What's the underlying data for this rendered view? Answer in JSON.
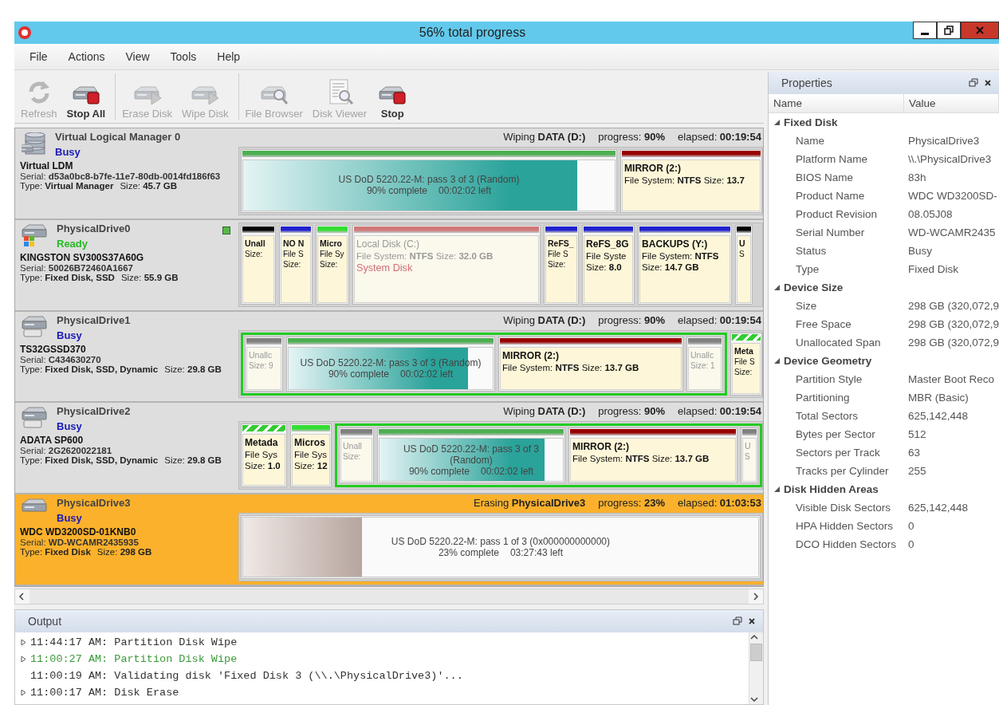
{
  "window": {
    "title": "56% total progress"
  },
  "menu": [
    "File",
    "Actions",
    "View",
    "Tools",
    "Help"
  ],
  "toolbar_groups": [
    [
      {
        "label": "Refresh",
        "kind": "refresh",
        "disabled": true
      },
      {
        "label": "Stop All",
        "kind": "stop",
        "disabled": false
      }
    ],
    [
      {
        "label": "Erase Disk",
        "kind": "play",
        "disabled": true
      },
      {
        "label": "Wipe Disk",
        "kind": "play",
        "disabled": true
      }
    ],
    [
      {
        "label": "File Browser",
        "kind": "browse",
        "disabled": true
      },
      {
        "label": "Disk Viewer",
        "kind": "viewer",
        "disabled": true
      },
      {
        "label": "Stop",
        "kind": "stop",
        "disabled": false
      }
    ]
  ],
  "disks": [
    {
      "kind": "virtual",
      "name": "Virtual Logical Manager 0",
      "status": {
        "text": "Busy",
        "kind": "busy"
      },
      "selected": false,
      "indicator": false,
      "model": "Virtual LDM",
      "serial": "Serial: **d53a0bc8-b7fe-11e7-80db-0014fd186f63**",
      "type": "Type: **Virtual Manager**",
      "size": "Size: **45.7 GB**",
      "task": {
        "action": "Wiping **DATA (D:)**",
        "progress": "progress: **90%**",
        "elapsed": "elapsed: **00:19:54**"
      },
      "partitions": [
        {
          "kind": "wipe",
          "color": "#4caf50",
          "level": 0.9,
          "text": "US DoD 5220.22-M: pass 3 of 3 (Random)",
          "complete": "90% complete",
          "left": "00:02:02 left"
        },
        {
          "kind": "volume",
          "color": "#990000",
          "dimmed": false,
          "label": "MIRROR (2:)",
          "lines": [
            "File System: **NTFS** Size: **13.7**"
          ]
        }
      ]
    },
    {
      "kind": "system",
      "name": "PhysicalDrive0",
      "status": {
        "text": "Ready",
        "kind": "ready"
      },
      "selected": false,
      "indicator": true,
      "model": "KINGSTON SV300S37A60G",
      "serial": "Serial: **50026B72460A1667**",
      "type": "Type: **Fixed Disk, SSD**",
      "size": "Size: **55.9 GB**",
      "partitions": [
        {
          "kind": "volume",
          "color": "#000000",
          "dimmed": false,
          "label": "Unall",
          "lines": [
            "Size:"
          ]
        },
        {
          "kind": "volume",
          "color": "#2020d0",
          "dimmed": false,
          "label": "NO N",
          "lines": [
            "File S",
            "Size:"
          ]
        },
        {
          "kind": "volume",
          "color": "#33dd33",
          "dimmed": false,
          "label": "Micro",
          "lines": [
            "File Sy",
            "Size:"
          ]
        },
        {
          "kind": "volume",
          "color": "#d07878",
          "dimmed": true,
          "label": "Local Disk (C:)",
          "lines": [
            "File System: **NTFS** Size: **32.0 GB**"
          ],
          "note": "System Disk"
        },
        {
          "kind": "volume",
          "color": "#2020d0",
          "dimmed": false,
          "label": "ReFS_",
          "lines": [
            "File S",
            "Size:"
          ]
        },
        {
          "kind": "volume",
          "color": "#2020d0",
          "dimmed": false,
          "label": "ReFS_8G",
          "lines": [
            "File Syste",
            "Size: **8.0**"
          ]
        },
        {
          "kind": "volume",
          "color": "#2020d0",
          "dimmed": false,
          "label": "BACKUPS (Y:)",
          "lines": [
            "File System: **NTFS**",
            "Size: **14.7 GB**"
          ]
        },
        {
          "kind": "volume",
          "color": "#000000",
          "dimmed": false,
          "label": "U",
          "lines": [
            "S"
          ]
        }
      ]
    },
    {
      "kind": "ssd",
      "name": "PhysicalDrive1",
      "status": {
        "text": "Busy",
        "kind": "busy"
      },
      "selected": false,
      "indicator": false,
      "model": "TS32GSSD370",
      "serial": "Serial: **C434630270**",
      "type": "Type: **Fixed Disk, SSD, Dynamic**",
      "size": "Size: **29.8 GB**",
      "task": {
        "action": "Wiping **DATA (D:)**",
        "progress": "progress: **90%**",
        "elapsed": "elapsed: **00:19:54**"
      },
      "partitions": [
        {
          "kind": "group",
          "children": [
            {
              "kind": "volume",
              "color": "#808080",
              "dimmed": true,
              "label": "Unallc",
              "lines": [
                "Size: 9"
              ]
            },
            {
              "kind": "wipe",
              "color": "#4caf50",
              "level": 0.88,
              "text": "US DoD 5220.22-M: pass 3 of 3 (Random)",
              "complete": "90% complete",
              "left": "00:02:02 left"
            },
            {
              "kind": "volume",
              "color": "#990000",
              "dimmed": false,
              "label": "MIRROR (2:)",
              "lines": [
                "File System: **NTFS** Size: **13.7 GB**"
              ]
            },
            {
              "kind": "volume",
              "color": "#808080",
              "dimmed": true,
              "label": "Unallc",
              "lines": [
                "Size: 1"
              ]
            }
          ]
        },
        {
          "kind": "volume",
          "color": "#33cc33",
          "striped": true,
          "dimmed": false,
          "label": "Meta",
          "lines": [
            "File S",
            "Size:"
          ]
        }
      ]
    },
    {
      "kind": "ssd",
      "name": "PhysicalDrive2",
      "status": {
        "text": "Busy",
        "kind": "busy"
      },
      "selected": false,
      "indicator": false,
      "model": "ADATA SP600",
      "serial": "Serial: **2G2620022181**",
      "type": "Type: **Fixed Disk, SSD, Dynamic**",
      "size": "Size: **29.8 GB**",
      "task": {
        "action": "Wiping **DATA (D:)**",
        "progress": "progress: **90%**",
        "elapsed": "elapsed: **00:19:54**"
      },
      "partitions": [
        {
          "kind": "volume",
          "color": "#33cc33",
          "striped": true,
          "dimmed": false,
          "label": "Metada",
          "lines": [
            "File Sys",
            "Size: **1.0**"
          ]
        },
        {
          "kind": "volume",
          "color": "#33dd33",
          "dimmed": false,
          "label": "Micros",
          "lines": [
            "File Sys",
            "Size: **12**"
          ]
        },
        {
          "kind": "group",
          "children": [
            {
              "kind": "volume",
              "color": "#808080",
              "dimmed": true,
              "label": "Unall",
              "lines": [
                "Size:"
              ]
            },
            {
              "kind": "wipe",
              "color": "#4caf50",
              "level": 0.9,
              "text": "US DoD 5220.22-M: pass 3 of 3 (Random)",
              "complete": "90% complete",
              "left": "00:02:02 left"
            },
            {
              "kind": "volume",
              "color": "#990000",
              "dimmed": false,
              "label": "MIRROR (2:)",
              "lines": [
                "File System: **NTFS** Size: **13.7 GB**"
              ]
            },
            {
              "kind": "volume",
              "color": "#808080",
              "dimmed": true,
              "label": "U",
              "lines": [
                "S"
              ]
            }
          ]
        }
      ]
    },
    {
      "kind": "hdd",
      "name": "PhysicalDrive3",
      "status": {
        "text": "Busy",
        "kind": "busy"
      },
      "selected": true,
      "indicator": false,
      "model": "WDC WD3200SD-01KNB0",
      "serial": "Serial: **WD-WCAMR2435935**",
      "type": "Type: **Fixed Disk**",
      "size": "Size: **298 GB**",
      "task": {
        "action": "Erasing **PhysicalDrive3**",
        "progress": "progress: **23%**",
        "elapsed": "elapsed: **01:03:53**"
      },
      "partitions": [
        {
          "kind": "erase",
          "level": 0.23,
          "text": "US DoD 5220.22-M: pass 1 of 3 (0x000000000000)",
          "complete": "23% complete",
          "left": "03:27:43 left"
        }
      ]
    }
  ],
  "output": {
    "title": "Output",
    "lines": [
      {
        "text": "11:44:17 AM: Partition Disk Wipe",
        "expandable": true,
        "color": "#333333"
      },
      {
        "text": "11:00:27 AM: Partition Disk Wipe",
        "expandable": true,
        "color": "#3a9a3a"
      },
      {
        "text": "11:00:19 AM: Validating disk 'Fixed Disk 3 (\\\\.\\PhysicalDrive3)'...",
        "expandable": false,
        "color": "#333333"
      },
      {
        "text": "11:00:17 AM: Disk Erase",
        "expandable": true,
        "color": "#333333"
      }
    ]
  },
  "properties": {
    "title": "Properties",
    "columns": [
      "Name",
      "Value"
    ],
    "groups": [
      {
        "name": "Fixed Disk",
        "expanded": true,
        "children": [
          {
            "name": "Name",
            "value": "PhysicalDrive3"
          },
          {
            "name": "Platform Name",
            "value": "\\\\.\\PhysicalDrive3"
          },
          {
            "name": "BIOS Name",
            "value": "83h"
          },
          {
            "name": "Product Name",
            "value": "WDC WD3200SD-"
          },
          {
            "name": "Product Revision",
            "value": "08.05J08"
          },
          {
            "name": "Serial Number",
            "value": "WD-WCAMR2435"
          },
          {
            "name": "Status",
            "value": "Busy"
          },
          {
            "name": "Type",
            "value": "Fixed Disk"
          }
        ]
      },
      {
        "name": "Device Size",
        "expanded": true,
        "children": [
          {
            "name": "Size",
            "value": "298 GB (320,072,9"
          },
          {
            "name": "Free Space",
            "value": "298 GB (320,072,9"
          },
          {
            "name": "Unallocated Span",
            "value": "298 GB (320,072,9"
          }
        ]
      },
      {
        "name": "Device Geometry",
        "expanded": true,
        "children": [
          {
            "name": "Partition Style",
            "value": "Master Boot Reco"
          },
          {
            "name": "Partitioning",
            "value": "MBR (Basic)"
          },
          {
            "name": "Total Sectors",
            "value": "625,142,448"
          },
          {
            "name": "Bytes per Sector",
            "value": "512"
          },
          {
            "name": "Sectors per Track",
            "value": "63"
          },
          {
            "name": "Tracks per Cylinder",
            "value": "255"
          }
        ]
      },
      {
        "name": "Disk Hidden Areas",
        "expanded": true,
        "children": [
          {
            "name": "Visible Disk Sectors",
            "value": "625,142,448"
          },
          {
            "name": "HPA Hidden Sectors",
            "value": "0"
          },
          {
            "name": "DCO Hidden Sectors",
            "value": "0"
          }
        ]
      }
    ]
  }
}
